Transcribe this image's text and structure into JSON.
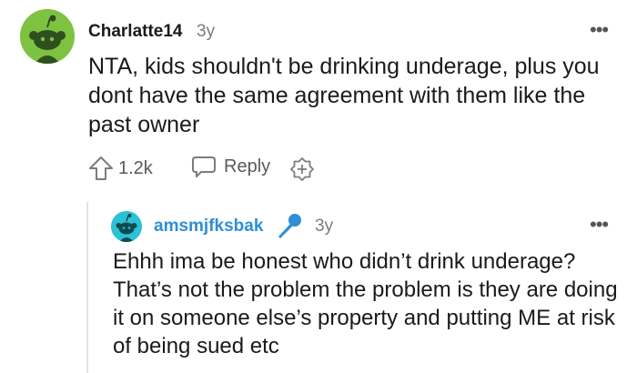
{
  "comment": {
    "author": "Charlatte14",
    "age": "3y",
    "body": "NTA, kids shouldn't be drinking underage, plus you dont have the same agreement with them like the past owner",
    "upvotes": "1.2k",
    "reply_label": "Reply",
    "more_label": "•••",
    "avatar_color": "#7ec242"
  },
  "reply": {
    "author": "amsmjfksbak",
    "age": "3y",
    "body": "Ehhh ima be honest who didn’t drink underage? That’s not the problem the problem is they are doing it on someone else’s property and putting ME at risk of being sued etc",
    "more_label": "•••",
    "author_color": "#2e8fd6",
    "avatar_color": "#2bc2d3"
  },
  "icons": [
    "snoo-avatar-icon",
    "upvote-arrow-icon",
    "reply-bubble-icon",
    "award-plus-icon",
    "microphone-icon",
    "more-options-icon"
  ]
}
